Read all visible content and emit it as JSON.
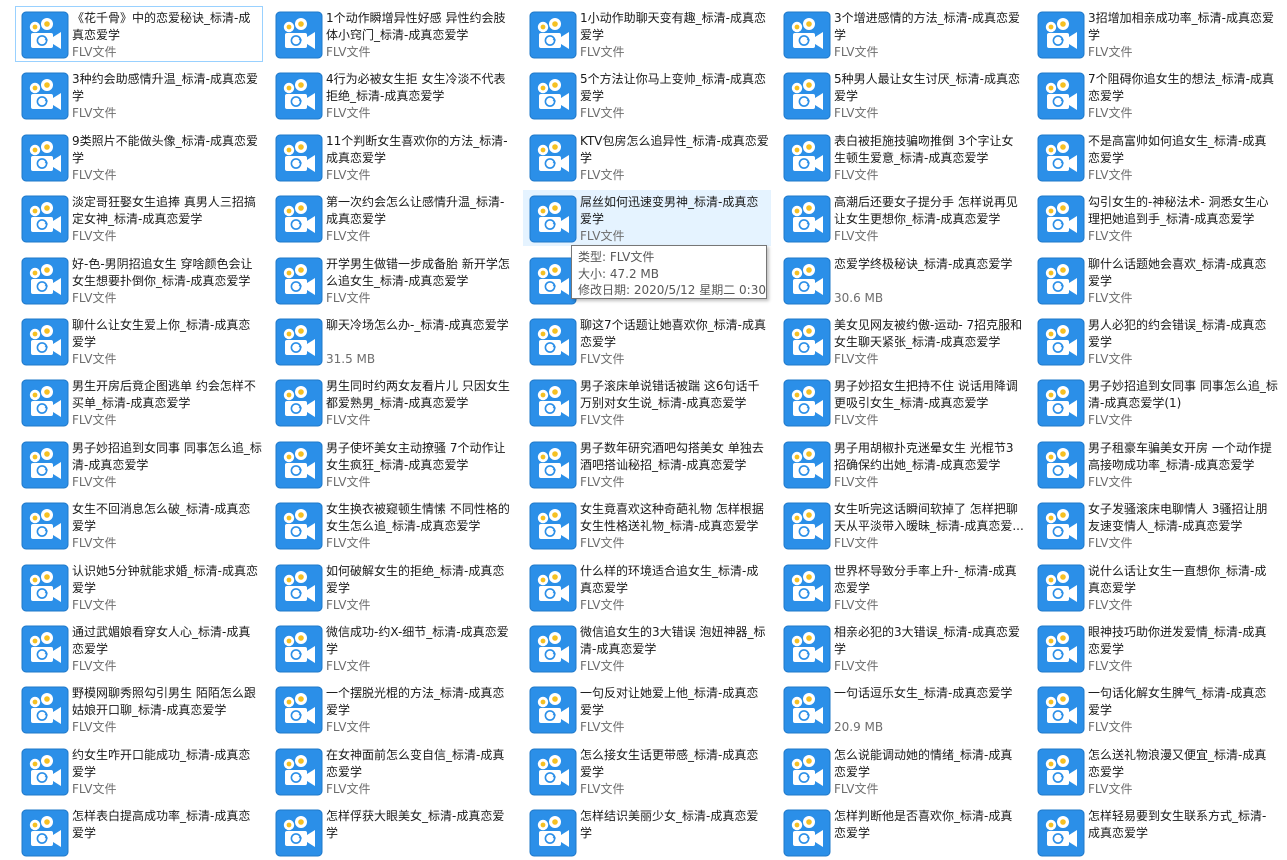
{
  "type_label": "FLV文件",
  "icon": "flv-video-file-icon",
  "colors": {
    "icon_bg": "#2b8fe8",
    "selection_border": "#99d1ff",
    "hover_bg": "#e5f3ff"
  },
  "files": [
    {
      "name": "《花千骨》中的恋爱秘诀_标清-成真恋爱学",
      "sub": "FLV文件"
    },
    {
      "name": "1个动作瞬增异性好感 异性约会肢体小窍门_标清-成真恋爱学",
      "sub": "FLV文件"
    },
    {
      "name": "1小动作助聊天变有趣_标清-成真恋爱学",
      "sub": "FLV文件"
    },
    {
      "name": "3个增进感情的方法_标清-成真恋爱学",
      "sub": "FLV文件"
    },
    {
      "name": "3招增加相亲成功率_标清-成真恋爱学",
      "sub": "FLV文件"
    },
    {
      "name": "3种约会助感情升温_标清-成真恋爱学",
      "sub": "FLV文件"
    },
    {
      "name": "4行为必被女生拒 女生冷淡不代表拒绝_标清-成真恋爱学",
      "sub": "FLV文件"
    },
    {
      "name": "5个方法让你马上变帅_标清-成真恋爱学",
      "sub": "FLV文件"
    },
    {
      "name": "5种男人最让女生讨厌_标清-成真恋爱学",
      "sub": "FLV文件"
    },
    {
      "name": "7个阻碍你追女生的想法_标清-成真恋爱学",
      "sub": "FLV文件"
    },
    {
      "name": "9类照片不能做头像_标清-成真恋爱学",
      "sub": "FLV文件"
    },
    {
      "name": "11个判断女生喜欢你的方法_标清-成真恋爱学",
      "sub": "FLV文件"
    },
    {
      "name": "KTV包房怎么追异性_标清-成真恋爱学",
      "sub": "FLV文件"
    },
    {
      "name": "表白被拒施技骗吻推倒 3个字让女生顿生爱意_标清-成真恋爱学",
      "sub": "FLV文件"
    },
    {
      "name": "不是高富帅如何追女生_标清-成真恋爱学",
      "sub": "FLV文件"
    },
    {
      "name": "淡定哥狂娶女生追捧 真男人三招搞定女神_标清-成真恋爱学",
      "sub": "FLV文件"
    },
    {
      "name": "第一次约会怎么让感情升温_标清-成真恋爱学",
      "sub": "FLV文件"
    },
    {
      "name": "屌丝如何迅速变男神_标清-成真恋爱学",
      "sub": "FLV文件"
    },
    {
      "name": "高潮后还要女子提分手 怎样说再见让女生更想你_标清-成真恋爱学",
      "sub": "FLV文件"
    },
    {
      "name": "勾引女生的-神秘法术- 洞悉女生心理把她追到手_标清-成真恋爱学",
      "sub": "FLV文件"
    },
    {
      "name": "好-色-男阴招追女生 穿啥颜色会让女生想要扑倒你_标清-成真恋爱学",
      "sub": "FLV文件"
    },
    {
      "name": "开学男生做错一步成备胎 新开学怎么追女生_标清-成真恋爱学",
      "sub": "FLV文件"
    },
    {
      "name": "",
      "sub": ""
    },
    {
      "name": "恋爱学终极秘诀_标清-成真恋爱学",
      "sub": "30.6 MB"
    },
    {
      "name": "聊什么话题她会喜欢_标清-成真恋爱学",
      "sub": "FLV文件"
    },
    {
      "name": "聊什么让女生爱上你_标清-成真恋爱学",
      "sub": "FLV文件"
    },
    {
      "name": "聊天冷场怎么办-_标清-成真恋爱学",
      "sub": "31.5 MB"
    },
    {
      "name": "聊这7个话题让她喜欢你_标清-成真恋爱学",
      "sub": "FLV文件"
    },
    {
      "name": "美女见网友被约傲-运动- 7招克服和女生聊天紧张_标清-成真恋爱学",
      "sub": "FLV文件"
    },
    {
      "name": "男人必犯的约会错误_标清-成真恋爱学",
      "sub": "FLV文件"
    },
    {
      "name": "男生开房后竟企图逃单 约会怎样不买单_标清-成真恋爱学",
      "sub": "FLV文件"
    },
    {
      "name": "男生同时约两女友看片儿 只因女生都爱熟男_标清-成真恋爱学",
      "sub": "FLV文件"
    },
    {
      "name": "男子滚床单说错话被踹 这6句话千万别对女生说_标清-成真恋爱学",
      "sub": "FLV文件"
    },
    {
      "name": "男子妙招女生把持不住 说话用降调更吸引女生_标清-成真恋爱学",
      "sub": "FLV文件"
    },
    {
      "name": "男子妙招追到女同事 同事怎么追_标清-成真恋爱学(1)",
      "sub": "FLV文件"
    },
    {
      "name": "男子妙招追到女同事 同事怎么追_标清-成真恋爱学",
      "sub": "FLV文件"
    },
    {
      "name": "男子使坏美女主动撩骚 7个动作让女生疯狂_标清-成真恋爱学",
      "sub": "FLV文件"
    },
    {
      "name": "男子数年研究酒吧勾搭美女 单独去酒吧搭讪秘招_标清-成真恋爱学",
      "sub": "FLV文件"
    },
    {
      "name": "男子用胡椒扑克迷晕女生 光棍节3招确保约出她_标清-成真恋爱学",
      "sub": "FLV文件"
    },
    {
      "name": "男子租豪车骗美女开房 一个动作提高接吻成功率_标清-成真恋爱学",
      "sub": "FLV文件"
    },
    {
      "name": "女生不回消息怎么破_标清-成真恋爱学",
      "sub": "FLV文件"
    },
    {
      "name": "女生换衣被窥顿生情愫 不同性格的女生怎么追_标清-成真恋爱学",
      "sub": "FLV文件"
    },
    {
      "name": "女生竟喜欢这种奇葩礼物 怎样根据女生性格送礼物_标清-成真恋爱学",
      "sub": "FLV文件"
    },
    {
      "name": "女生听完这话瞬间软掉了 怎样把聊天从平淡带入暧昧_标清-成真恋爱...",
      "sub": "FLV文件"
    },
    {
      "name": "女子发骚滚床电聊情人 3骚招让朋友速变情人_标清-成真恋爱学",
      "sub": "FLV文件"
    },
    {
      "name": "认识她5分钟就能求婚_标清-成真恋爱学",
      "sub": "FLV文件"
    },
    {
      "name": "如何破解女生的拒绝_标清-成真恋爱学",
      "sub": "FLV文件"
    },
    {
      "name": "什么样的环境适合追女生_标清-成真恋爱学",
      "sub": "FLV文件"
    },
    {
      "name": "世界杯导致分手率上升-_标清-成真恋爱学",
      "sub": "FLV文件"
    },
    {
      "name": "说什么话让女生一直想你_标清-成真恋爱学",
      "sub": "FLV文件"
    },
    {
      "name": "通过武媚娘看穿女人心_标清-成真恋爱学",
      "sub": "FLV文件"
    },
    {
      "name": "微信成功-约X-细节_标清-成真恋爱学",
      "sub": "FLV文件"
    },
    {
      "name": "微信追女生的3大错误 泡妞神器_标清-成真恋爱学",
      "sub": "FLV文件"
    },
    {
      "name": "相亲必犯的3大错误_标清-成真恋爱学",
      "sub": "FLV文件"
    },
    {
      "name": "眼神技巧助你迸发爱情_标清-成真恋爱学",
      "sub": "FLV文件"
    },
    {
      "name": "野模网聊秀照勾引男生 陌陌怎么跟姑娘开口聊_标清-成真恋爱学",
      "sub": "FLV文件"
    },
    {
      "name": "一个摆脱光棍的方法_标清-成真恋爱学",
      "sub": "FLV文件"
    },
    {
      "name": "一句反对让她爱上他_标清-成真恋爱学",
      "sub": "FLV文件"
    },
    {
      "name": "一句话逗乐女生_标清-成真恋爱学",
      "sub": "20.9 MB"
    },
    {
      "name": "一句话化解女生脾气_标清-成真恋爱学",
      "sub": "FLV文件"
    },
    {
      "name": "约女生咋开口能成功_标清-成真恋爱学",
      "sub": "FLV文件"
    },
    {
      "name": "在女神面前怎么变自信_标清-成真恋爱学",
      "sub": "FLV文件"
    },
    {
      "name": "怎么接女生话更带感_标清-成真恋爱学",
      "sub": "FLV文件"
    },
    {
      "name": "怎么说能调动她的情绪_标清-成真恋爱学",
      "sub": "FLV文件"
    },
    {
      "name": "怎么送礼物浪漫又便宜_标清-成真恋爱学",
      "sub": "FLV文件"
    },
    {
      "name": "怎样表白提高成功率_标清-成真恋爱学",
      "sub": ""
    },
    {
      "name": "怎样俘获大眼美女_标清-成真恋爱学",
      "sub": ""
    },
    {
      "name": "怎样结识美丽少女_标清-成真恋爱学",
      "sub": ""
    },
    {
      "name": "怎样判断他是否喜欢你_标清-成真恋爱学",
      "sub": ""
    },
    {
      "name": "怎样轻易要到女生联系方式_标清-成真恋爱学",
      "sub": ""
    }
  ],
  "tooltip": {
    "type_line": "类型: FLV文件",
    "size_line": "大小: 47.2 MB",
    "date_line": "修改日期: 2020/5/12 星期二 0:30"
  }
}
